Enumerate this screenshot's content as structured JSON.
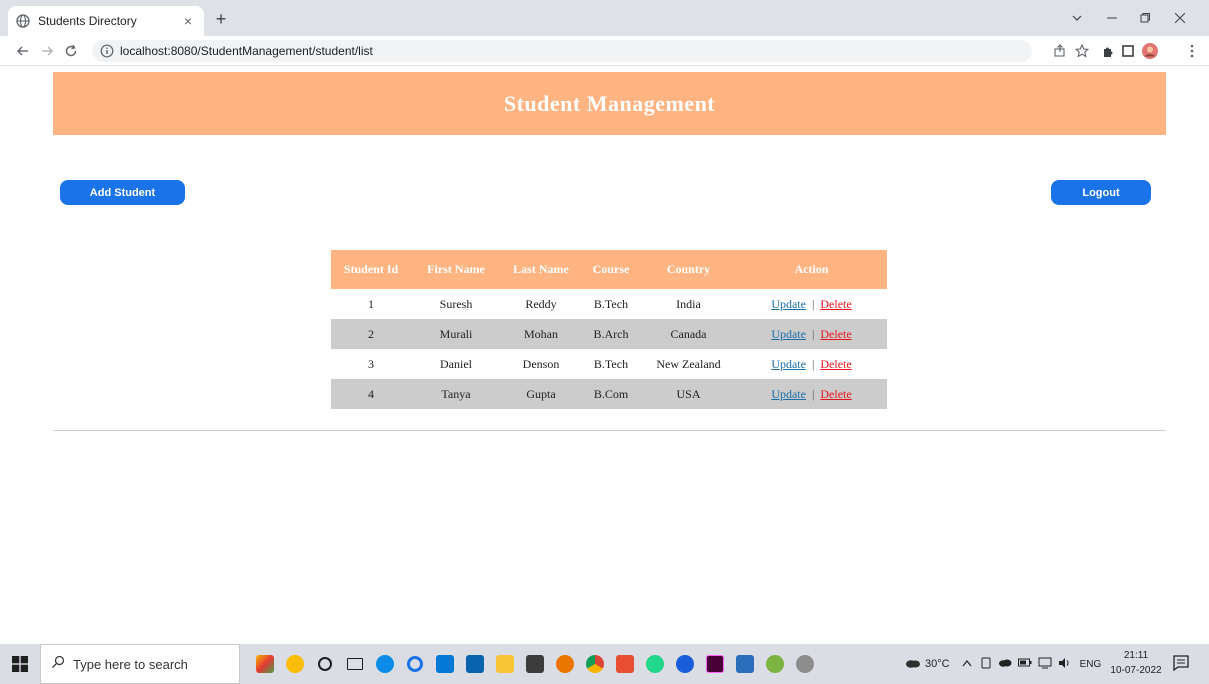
{
  "browser": {
    "tab_title": "Students Directory",
    "tab_close": "×",
    "new_tab": "+",
    "url": "localhost:8080/StudentManagement/student/list"
  },
  "page": {
    "heading": "Student Management",
    "add_button": "Add Student",
    "logout_button": "Logout"
  },
  "table": {
    "headers": [
      "Student Id",
      "First Name",
      "Last Name",
      "Course",
      "Country",
      "Action"
    ],
    "rows": [
      {
        "id": "1",
        "first": "Suresh",
        "last": "Reddy",
        "course": "B.Tech",
        "country": "India"
      },
      {
        "id": "2",
        "first": "Murali",
        "last": "Mohan",
        "course": "B.Arch",
        "country": "Canada"
      },
      {
        "id": "3",
        "first": "Daniel",
        "last": "Denson",
        "course": "B.Tech",
        "country": "New Zealand"
      },
      {
        "id": "4",
        "first": "Tanya",
        "last": "Gupta",
        "course": "B.Com",
        "country": "USA"
      }
    ],
    "update_label": "Update",
    "separator": "|",
    "delete_label": "Delete"
  },
  "taskbar": {
    "search_placeholder": "Type here to search",
    "weather": "30°C",
    "language": "ENG",
    "time": "21:11",
    "date": "10-07-2022"
  },
  "colors": {
    "header_bg": "#ffb482",
    "button_bg": "#1a73e8",
    "row_alt_bg": "#cccccc",
    "update_link": "#1a6ea8",
    "delete_link": "#e8141e"
  }
}
